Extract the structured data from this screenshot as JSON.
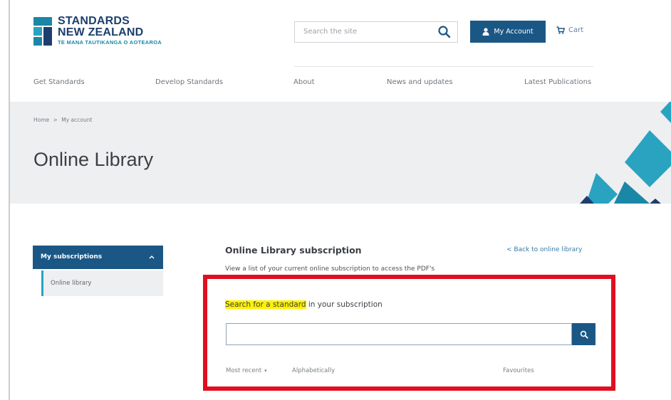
{
  "logo": {
    "line1": "STANDARDS",
    "line2": "NEW ZEALAND",
    "line3": "TE MANA TAUTIKANGA O AOTEAROA"
  },
  "header": {
    "search_placeholder": "Search the site",
    "account_label": "My Account",
    "cart_label": "Cart"
  },
  "nav": {
    "items": [
      "Get Standards",
      "Develop Standards",
      "About",
      "News and updates",
      "Latest Publications"
    ]
  },
  "breadcrumb": {
    "home": "Home",
    "separator": ">",
    "current": "My account"
  },
  "banner": {
    "title": "Online Library"
  },
  "sidebar": {
    "header": "My subscriptions",
    "items": [
      "Online library"
    ]
  },
  "main": {
    "title": "Online Library subscription",
    "back_link": "< Back to online library",
    "description": "View a list of your current online subscription to access the PDF's",
    "search_label_highlight": "Search for a standard",
    "search_label_rest": " in your subscription",
    "search_value": "",
    "sort_options": {
      "most_recent": "Most recent",
      "alphabetically": "Alphabetically",
      "favourites": "Favourites"
    }
  },
  "colors": {
    "brand_navy": "#1b5785",
    "accent_teal": "#2aa3c0",
    "highlight": "#fff100",
    "annotation_red": "#e00f1f"
  }
}
